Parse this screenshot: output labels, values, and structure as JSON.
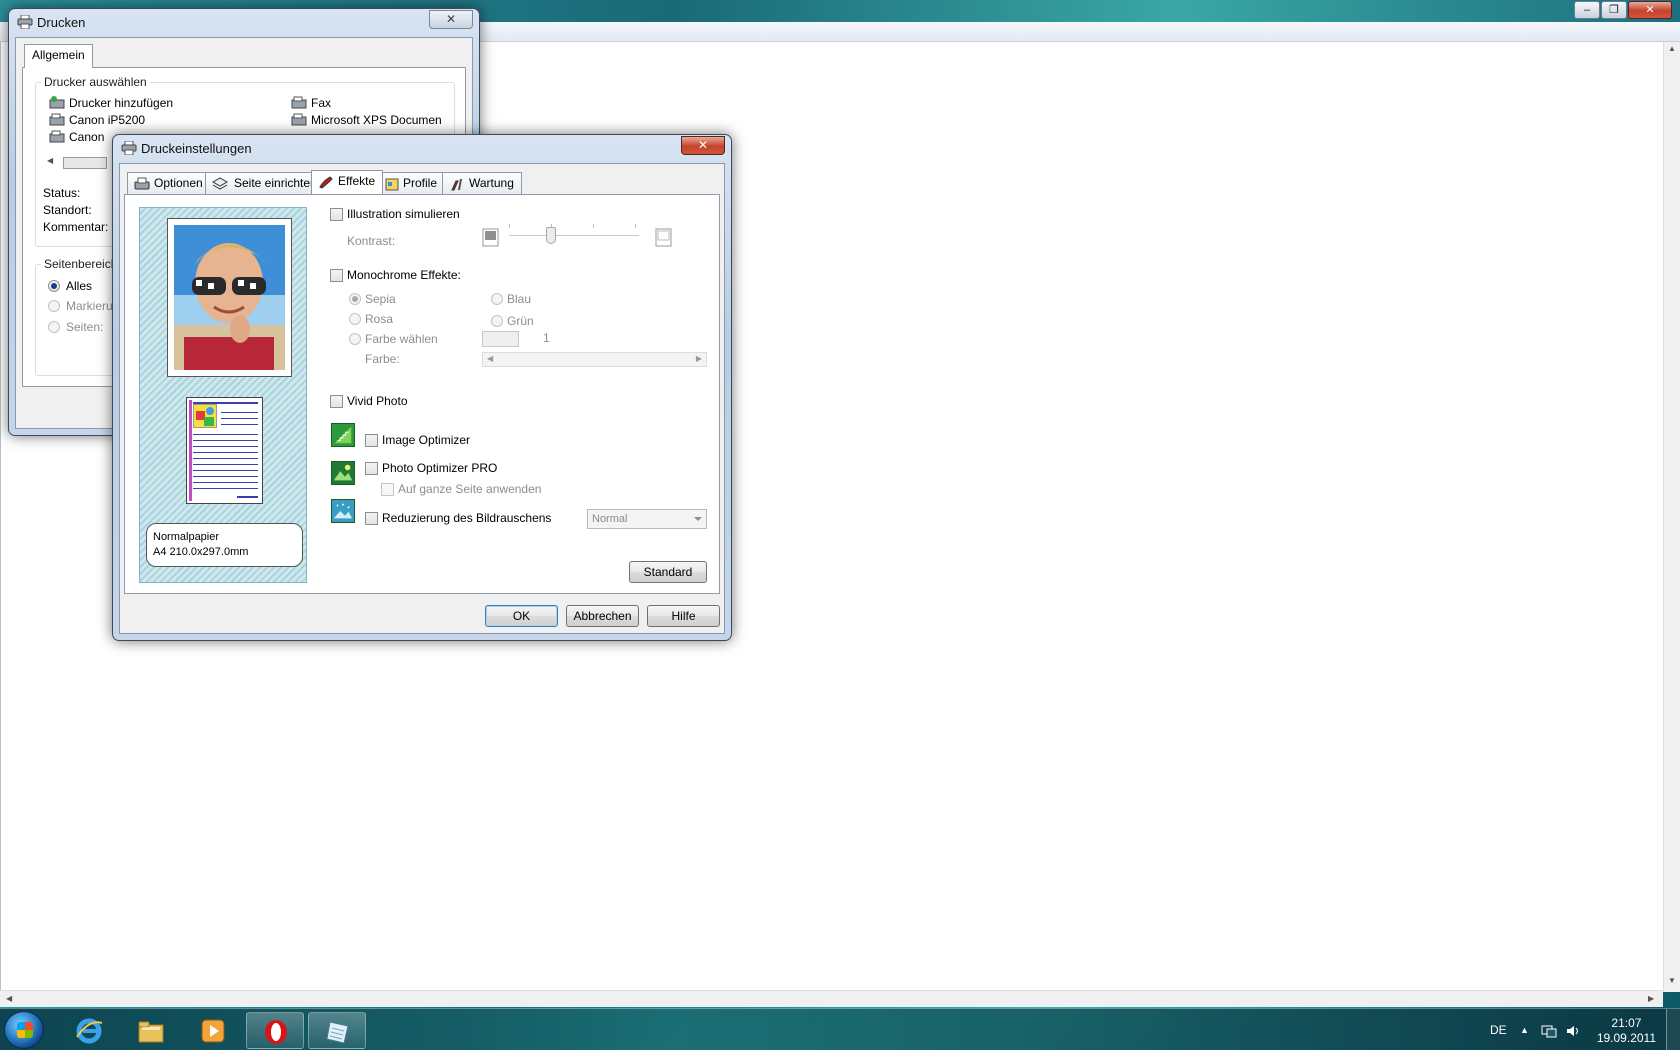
{
  "colors": {
    "accent": "#3c7fb1",
    "close_red": "#c4432c",
    "preview_teal": "#a9d4de",
    "doc_lines": "#3a3fae"
  },
  "print_dialog": {
    "title": "Drucken",
    "tab": "Allgemein",
    "printer_group": "Drucker auswählen",
    "printers": [
      "Drucker hinzufügen",
      "Canon iP5200",
      "Canon",
      "Fax",
      "Microsoft XPS Documen"
    ],
    "status_label": "Status:",
    "location_label": "Standort:",
    "comment_label": "Kommentar:",
    "page_range_group": "Seitenbereich",
    "range_all": "Alles",
    "range_selection": "Markierun",
    "range_pages": "Seiten:",
    "close": "✕"
  },
  "settings_dialog": {
    "title": "Druckeinstellungen",
    "close": "✕",
    "tabs": [
      "Optionen",
      "Seite einrichten",
      "Effekte",
      "Profile",
      "Wartung"
    ],
    "active_tab": "Effekte",
    "paper_type": "Normalpapier",
    "paper_size": "A4 210.0x297.0mm",
    "illustration_label": "Illustration simulieren",
    "contrast_label": "Kontrast:",
    "contrast_level": 0.35,
    "mono_label": "Monochrome Effekte:",
    "mono_options": [
      "Sepia",
      "Blau",
      "Rosa",
      "Grün",
      "Farbe wählen"
    ],
    "selected_mono": "Sepia",
    "color_value": "1",
    "color_label": "Farbe:",
    "vivid_label": "Vivid Photo",
    "image_optimizer_label": "Image Optimizer",
    "photo_optimizer_label": "Photo Optimizer PRO",
    "whole_page_label": "Auf ganze Seite anwenden",
    "noise_label": "Reduzierung des Bildrauschens",
    "noise_value": "Normal",
    "standard_button": "Standard",
    "ok_button": "OK",
    "cancel_button": "Abbrechen",
    "help_button": "Hilfe"
  },
  "main_window": {
    "minimize": "–",
    "maximize": "❐",
    "close": "✕"
  },
  "taskbar": {
    "language": "DE",
    "time": "21:07",
    "date": "19.09.2011",
    "tray_arrow": "▲"
  }
}
